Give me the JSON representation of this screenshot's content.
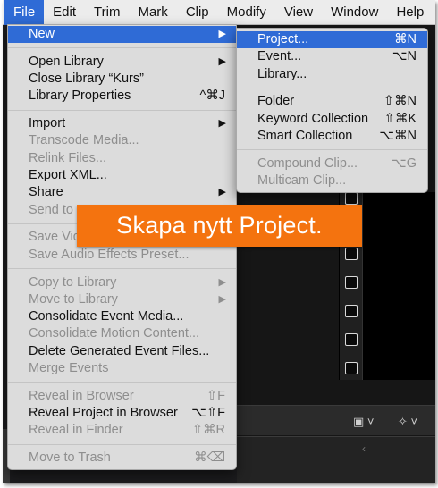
{
  "menubar": {
    "items": [
      "File",
      "Edit",
      "Trim",
      "Mark",
      "Clip",
      "Modify",
      "View",
      "Window",
      "Help"
    ],
    "active_index": 0
  },
  "file_menu": {
    "new": {
      "label": "New"
    },
    "open_library": {
      "label": "Open Library"
    },
    "close_library": {
      "label": "Close Library “Kurs”"
    },
    "library_properties": {
      "label": "Library Properties",
      "shortcut": "^⌘J"
    },
    "import": {
      "label": "Import"
    },
    "transcode_media": {
      "label": "Transcode Media..."
    },
    "relink_files": {
      "label": "Relink Files..."
    },
    "export_xml": {
      "label": "Export XML..."
    },
    "share": {
      "label": "Share"
    },
    "send_to": {
      "label": "Send to"
    },
    "save_video": {
      "label": "Save Vid"
    },
    "save_audio_effects_preset": {
      "label": "Save Audio Effects Preset..."
    },
    "copy_to_library": {
      "label": "Copy to Library"
    },
    "move_to_library": {
      "label": "Move to Library"
    },
    "consolidate_event_media": {
      "label": "Consolidate Event Media..."
    },
    "consolidate_motion_content": {
      "label": "Consolidate Motion Content..."
    },
    "delete_generated_event_files": {
      "label": "Delete Generated Event Files..."
    },
    "merge_events": {
      "label": "Merge Events"
    },
    "reveal_in_browser": {
      "label": "Reveal in Browser",
      "shortcut": "⇧F"
    },
    "reveal_project_in_browser": {
      "label": "Reveal Project in Browser",
      "shortcut": "⌥⇧F"
    },
    "reveal_in_finder": {
      "label": "Reveal in Finder",
      "shortcut": "⇧⌘R"
    },
    "move_to_trash": {
      "label": "Move to Trash",
      "shortcut": "⌘⌫"
    }
  },
  "new_submenu": {
    "project": {
      "label": "Project...",
      "shortcut": "⌘N"
    },
    "event": {
      "label": "Event...",
      "shortcut": "⌥N"
    },
    "library": {
      "label": "Library..."
    },
    "folder": {
      "label": "Folder",
      "shortcut": "⇧⌘N"
    },
    "keyword_collection": {
      "label": "Keyword Collection",
      "shortcut": "⇧⌘K"
    },
    "smart_collection": {
      "label": "Smart Collection",
      "shortcut": "⌥⌘N"
    },
    "compound_clip": {
      "label": "Compound Clip...",
      "shortcut": "⌥G"
    },
    "multicam_clip": {
      "label": "Multicam Clip..."
    }
  },
  "callout": {
    "text": "Skapa nytt Project."
  },
  "icons": {
    "submenu_arrow": "triangle-right-icon",
    "viewer_menu": "viewer-display-icon",
    "transform": "transform-tool-icon",
    "timeline_back": "chevron-left-icon"
  },
  "colors": {
    "highlight": "#2f6bd6",
    "callout": "#f4730f",
    "menu_bg": "#dcdcdc",
    "disabled_text": "#8e8e8e"
  }
}
